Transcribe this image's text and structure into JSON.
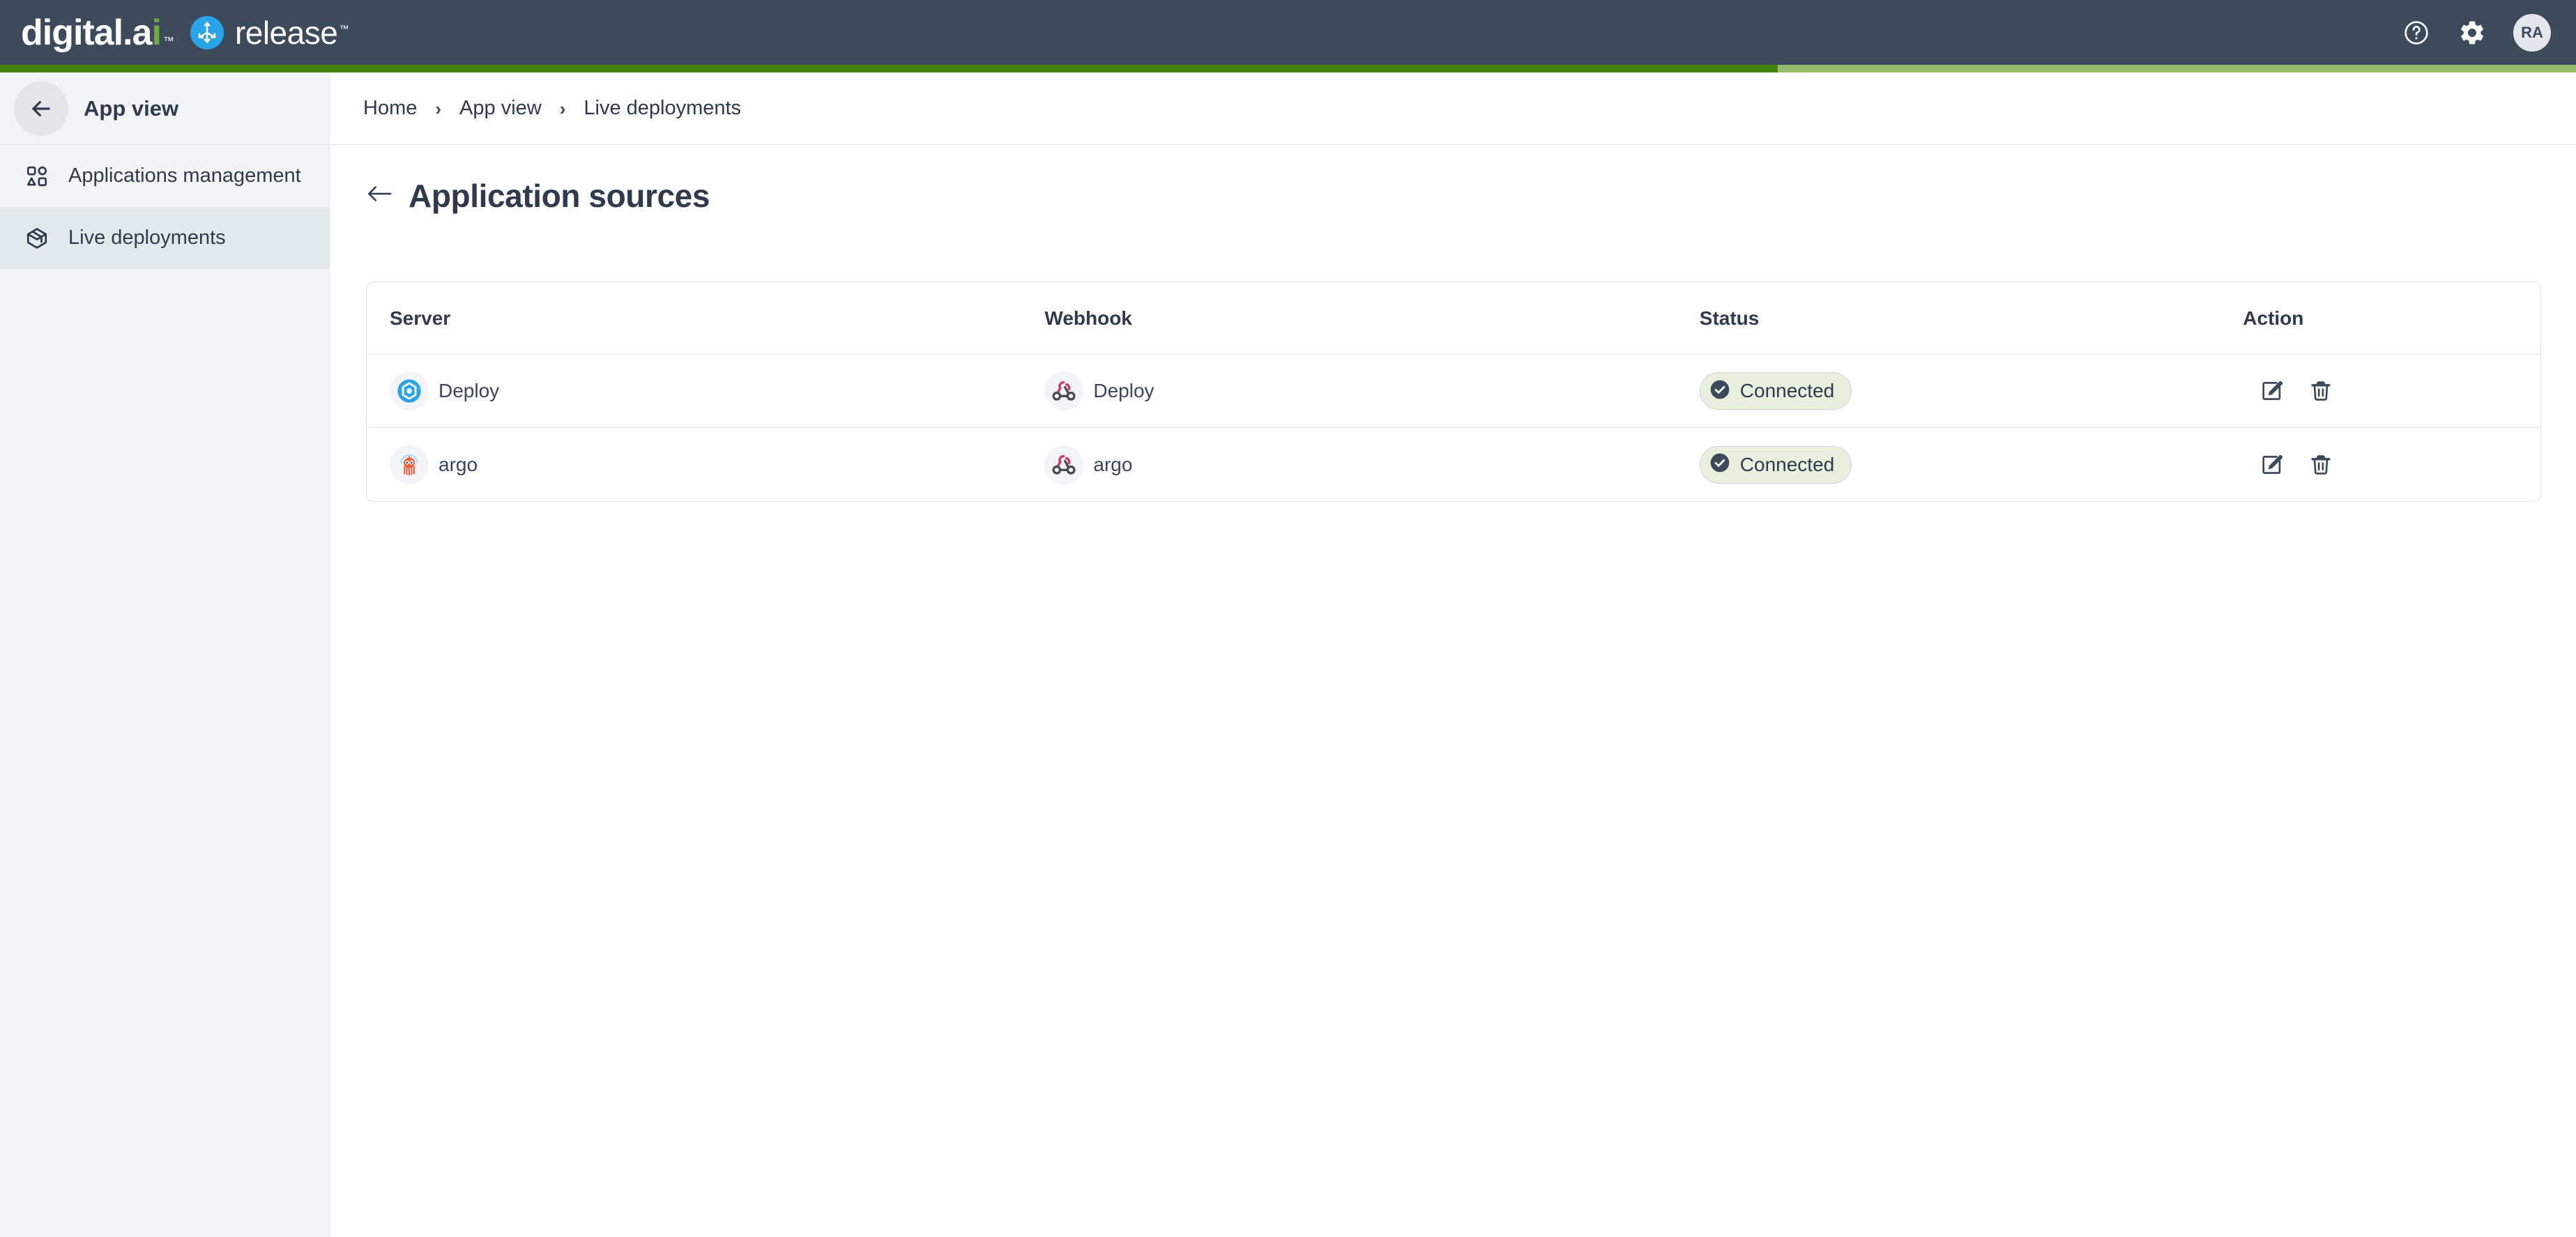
{
  "navbar": {
    "brand_primary": "digital.a",
    "brand_primary_tail": "i",
    "brand_tm": "™",
    "brand_secondary": "release",
    "brand_secondary_tm": "™",
    "help_icon": "help-circle-icon",
    "settings_icon": "gear-icon",
    "avatar_initials": "RA",
    "bg_color": "#3d4a5c"
  },
  "progress": {
    "percent": 69,
    "fill_color": "#458500",
    "track_color": "#95bb6d"
  },
  "sidebar": {
    "header": {
      "back_icon": "arrow-left-icon",
      "label": "App view"
    },
    "items": [
      {
        "label": "Applications management",
        "icon": "shapes-grid-icon",
        "active": false
      },
      {
        "label": "Live deployments",
        "icon": "package-box-icon",
        "active": true
      }
    ],
    "active_bg": "#e2e8ec",
    "bg": "#f3f4f6"
  },
  "breadcrumb": {
    "separator": "›",
    "items": [
      "Home",
      "App view",
      "Live deployments"
    ]
  },
  "page": {
    "back_icon": "arrow-left-icon",
    "title": "Application sources"
  },
  "table": {
    "columns": [
      "Server",
      "Webhook",
      "Status",
      "Action"
    ],
    "rows": [
      {
        "server": {
          "name": "Deploy",
          "icon": "deploy-logo-icon"
        },
        "webhook": {
          "name": "Deploy",
          "icon": "webhook-icon"
        },
        "status": {
          "label": "Connected",
          "icon": "check-circle-icon",
          "bg": "#e8efdc"
        },
        "actions": [
          {
            "name": "edit-button",
            "icon": "pencil-square-icon"
          },
          {
            "name": "delete-button",
            "icon": "trash-icon"
          }
        ]
      },
      {
        "server": {
          "name": "argo",
          "icon": "argo-octopus-icon"
        },
        "webhook": {
          "name": "argo",
          "icon": "webhook-icon"
        },
        "status": {
          "label": "Connected",
          "icon": "check-circle-icon",
          "bg": "#e8efdc"
        },
        "actions": [
          {
            "name": "edit-button",
            "icon": "pencil-square-icon"
          },
          {
            "name": "delete-button",
            "icon": "trash-icon"
          }
        ]
      }
    ]
  }
}
